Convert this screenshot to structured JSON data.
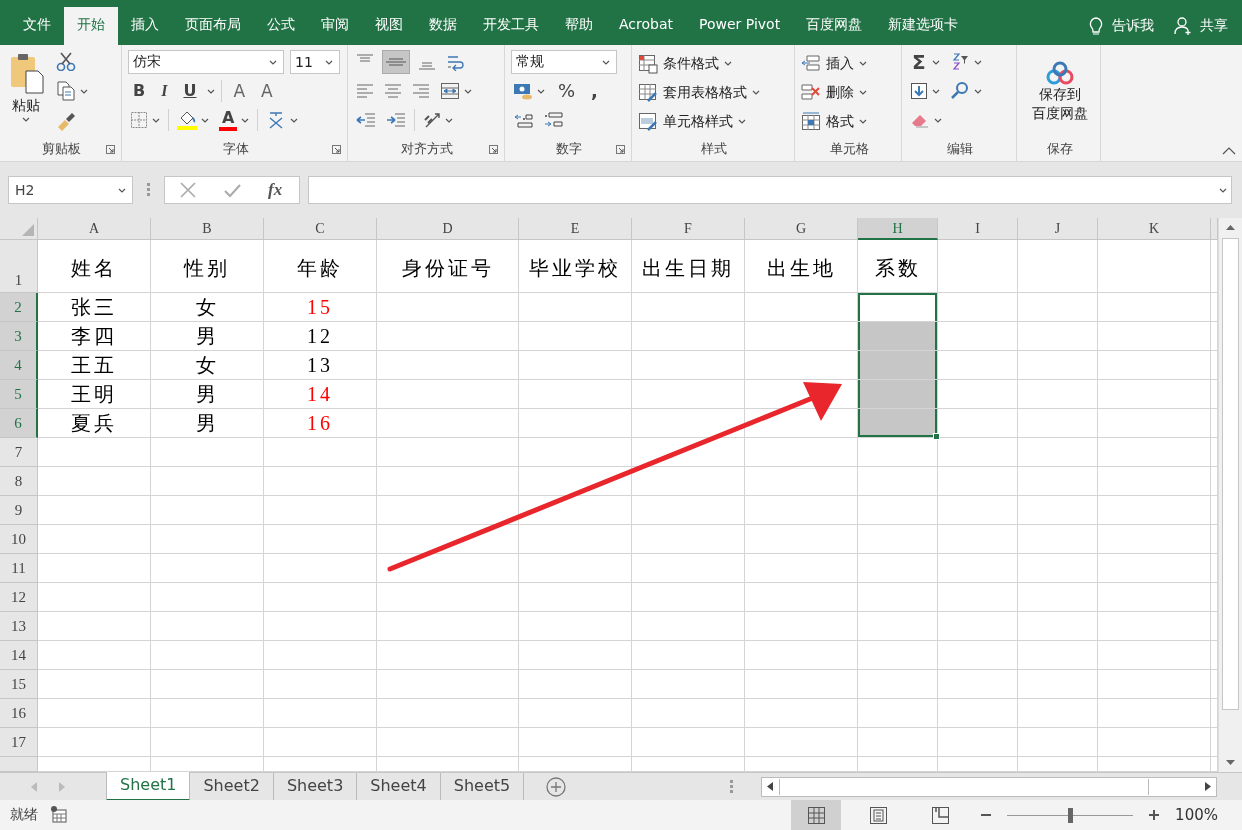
{
  "menu_tabs": [
    {
      "label": "文件",
      "selected": false
    },
    {
      "label": "开始",
      "selected": true
    },
    {
      "label": "插入",
      "selected": false
    },
    {
      "label": "页面布局",
      "selected": false
    },
    {
      "label": "公式",
      "selected": false
    },
    {
      "label": "审阅",
      "selected": false
    },
    {
      "label": "视图",
      "selected": false
    },
    {
      "label": "数据",
      "selected": false
    },
    {
      "label": "开发工具",
      "selected": false
    },
    {
      "label": "帮助",
      "selected": false
    },
    {
      "label": "Acrobat",
      "selected": false
    },
    {
      "label": "Power Pivot",
      "selected": false
    },
    {
      "label": "百度网盘",
      "selected": false
    },
    {
      "label": "新建选项卡",
      "selected": false
    }
  ],
  "tell_me": "告诉我",
  "share": "共享",
  "ribbon": {
    "clipboard": {
      "label": "剪贴板",
      "paste": "粘贴"
    },
    "font": {
      "label": "字体",
      "font_name": "仿宋",
      "font_size": "11",
      "bold": "B",
      "italic": "I",
      "underline": "U",
      "grow": "A",
      "shrink": "A",
      "font_color": "A"
    },
    "alignment": {
      "label": "对齐方式",
      "middle_align_selected": true
    },
    "number": {
      "label": "数字",
      "format": "常规",
      "percent": "%",
      "comma": ","
    },
    "styles": {
      "label": "样式",
      "items": [
        "条件格式",
        "套用表格格式",
        "单元格样式"
      ]
    },
    "cells": {
      "label": "单元格",
      "items": [
        "插入",
        "删除",
        "格式"
      ]
    },
    "editing": {
      "label": "编辑",
      "sum": "Σ"
    },
    "save": {
      "label": "保存",
      "button": [
        "保存到",
        "百度网盘"
      ]
    }
  },
  "formula_bar": {
    "name_box": "H2",
    "fx": "fx"
  },
  "columns": [
    {
      "label": "A",
      "selected": false
    },
    {
      "label": "B",
      "selected": false
    },
    {
      "label": "C",
      "selected": false
    },
    {
      "label": "D",
      "selected": false
    },
    {
      "label": "E",
      "selected": false
    },
    {
      "label": "F",
      "selected": false
    },
    {
      "label": "G",
      "selected": false
    },
    {
      "label": "H",
      "selected": true
    },
    {
      "label": "I",
      "selected": false
    },
    {
      "label": "J",
      "selected": false
    },
    {
      "label": "K",
      "selected": false
    }
  ],
  "grid_rows": [
    {
      "header": "1",
      "selected": false,
      "cells": [
        {
          "text": "姓名"
        },
        {
          "text": "性别"
        },
        {
          "text": "年龄"
        },
        {
          "text": "身份证号"
        },
        {
          "text": "毕业学校"
        },
        {
          "text": "出生日期"
        },
        {
          "text": "出生地"
        },
        {
          "text": "系数"
        }
      ]
    },
    {
      "header": "2",
      "selected": true,
      "cells": [
        {
          "text": "张三"
        },
        {
          "text": "女"
        },
        {
          "text": "15",
          "color": "#ff0000"
        }
      ]
    },
    {
      "header": "3",
      "selected": true,
      "cells": [
        {
          "text": "李四"
        },
        {
          "text": "男"
        },
        {
          "text": "12",
          "color": "#000000"
        }
      ]
    },
    {
      "header": "4",
      "selected": true,
      "cells": [
        {
          "text": "王五"
        },
        {
          "text": "女"
        },
        {
          "text": "13",
          "color": "#000000"
        }
      ]
    },
    {
      "header": "5",
      "selected": true,
      "cells": [
        {
          "text": "王明"
        },
        {
          "text": "男"
        },
        {
          "text": "14",
          "color": "#ff0000"
        }
      ]
    },
    {
      "header": "6",
      "selected": true,
      "cells": [
        {
          "text": "夏兵"
        },
        {
          "text": "男"
        },
        {
          "text": "16",
          "color": "#ff0000"
        }
      ]
    },
    {
      "header": "7",
      "selected": false,
      "cells": []
    },
    {
      "header": "8",
      "selected": false,
      "cells": []
    },
    {
      "header": "9",
      "selected": false,
      "cells": []
    },
    {
      "header": "10",
      "selected": false,
      "cells": []
    },
    {
      "header": "11",
      "selected": false,
      "cells": []
    },
    {
      "header": "12",
      "selected": false,
      "cells": []
    },
    {
      "header": "13",
      "selected": false,
      "cells": []
    },
    {
      "header": "14",
      "selected": false,
      "cells": []
    },
    {
      "header": "15",
      "selected": false,
      "cells": []
    },
    {
      "header": "16",
      "selected": false,
      "cells": []
    },
    {
      "header": "17",
      "selected": false,
      "cells": []
    }
  ],
  "sheet_tabs": [
    {
      "label": "Sheet1",
      "selected": true
    },
    {
      "label": "Sheet2",
      "selected": false
    },
    {
      "label": "Sheet3",
      "selected": false
    },
    {
      "label": "Sheet4",
      "selected": false
    },
    {
      "label": "Sheet5",
      "selected": false
    }
  ],
  "status_bar": {
    "status": "就绪",
    "views": [
      {
        "kind": "normal",
        "selected": true
      },
      {
        "kind": "page_layout",
        "selected": false
      },
      {
        "kind": "page_break",
        "selected": false
      }
    ],
    "zoom": {
      "level": 0.5,
      "reading": "100%"
    }
  }
}
